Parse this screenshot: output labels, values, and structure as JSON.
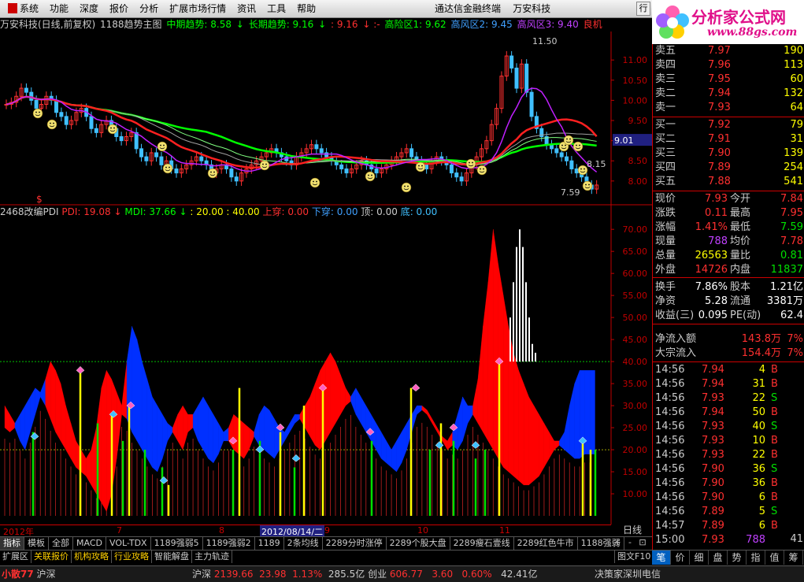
{
  "menubar": {
    "items": [
      "系统",
      "功能",
      "深度",
      "报价",
      "分析",
      "扩展市场行情",
      "资讯",
      "工具",
      "帮助"
    ],
    "app_title": "通达信金融终端",
    "company": "万安科技",
    "win_btn_label": "行"
  },
  "brand": {
    "name": "分析家公式网",
    "url": "www.88gs.com"
  },
  "price_chart": {
    "header": {
      "title": "万安科技(日线,前复权)",
      "indicator": "1188趋势主图",
      "mid_label": "中期趋势: 8.58",
      "long_label": "长期趋势: 9.16",
      "v3": ": 9.16",
      "risk_high": "高险区1: 9.62",
      "risk2": "高风区2: 9.45",
      "risk3": "高风区3: 9.40",
      "tail": "良机"
    },
    "y_ticks": [
      "11.00",
      "10.50",
      "10.00",
      "9.50",
      "9.00",
      "8.50",
      "8.00"
    ],
    "current_price_box": "9.01",
    "annot_high": "11.50",
    "annot_low": "7.59",
    "annot_mid": "8.15"
  },
  "indicator_chart": {
    "header": {
      "name": "2468改编PDI",
      "pdi": "PDI: 19.08",
      "mdi": "MDI: 37.66",
      "levels": ": 20.00 : 40.00",
      "up": "上穿: 0.00",
      "down": "下穿: 0.00",
      "top": "顶: 0.00",
      "bottom": "底: 0.00"
    },
    "y_ticks": [
      "70.00",
      "65.00",
      "60.00",
      "55.00",
      "50.00",
      "45.00",
      "40.00",
      "35.00",
      "30.00",
      "25.00",
      "20.00",
      "15.00",
      "10.00"
    ]
  },
  "date_axis": {
    "labels": [
      "2012年",
      "7",
      "8",
      "2012/08/14/二",
      "9",
      "10",
      "11"
    ],
    "period": "日线"
  },
  "tabs": [
    "指标",
    "模板",
    "全部",
    "MACD",
    "VOL-TDX",
    "1189强弱5",
    "1189强弱2",
    "1189",
    "2条均线",
    "2289分时涨停",
    "2289个股大盘",
    "2289瘦石壹线",
    "2289红色牛市",
    "1188强弱"
  ],
  "ctrl_buttons": [
    "+",
    "-",
    "⊡"
  ],
  "tabs2": [
    "扩展区",
    "关联报价",
    "机构攻略",
    "行业攻略",
    "智能解盘",
    "主力轨迹"
  ],
  "tabs2_f10": "图文F10",
  "order_book": {
    "sell": [
      {
        "label": "卖五",
        "price": "7.97",
        "vol": "190"
      },
      {
        "label": "卖四",
        "price": "7.96",
        "vol": "113"
      },
      {
        "label": "卖三",
        "price": "7.95",
        "vol": "60"
      },
      {
        "label": "卖二",
        "price": "7.94",
        "vol": "132"
      },
      {
        "label": "卖一",
        "price": "7.93",
        "vol": "64"
      }
    ],
    "buy": [
      {
        "label": "买一",
        "price": "7.92",
        "vol": "79"
      },
      {
        "label": "买二",
        "price": "7.91",
        "vol": "31"
      },
      {
        "label": "买三",
        "price": "7.90",
        "vol": "139"
      },
      {
        "label": "买四",
        "price": "7.89",
        "vol": "254"
      },
      {
        "label": "买五",
        "price": "7.88",
        "vol": "541"
      }
    ]
  },
  "quote": [
    {
      "l1": "现价",
      "v1": "7.93",
      "l2": "今开",
      "v2": "7.84",
      "c1": "#ff3030",
      "c2": "#ff3030"
    },
    {
      "l1": "涨跌",
      "v1": "0.11",
      "l2": "最高",
      "v2": "7.95",
      "c1": "#ff3030",
      "c2": "#ff3030"
    },
    {
      "l1": "涨幅",
      "v1": "1.41%",
      "l2": "最低",
      "v2": "7.59",
      "c1": "#ff3030",
      "c2": "#00e000"
    },
    {
      "l1": "现量",
      "v1": "788",
      "l2": "均价",
      "v2": "7.78",
      "c1": "#c040ff",
      "c2": "#ff3030"
    },
    {
      "l1": "总量",
      "v1": "26563",
      "l2": "量比",
      "v2": "0.81",
      "c1": "#ffff00",
      "c2": "#00e000"
    },
    {
      "l1": "外盘",
      "v1": "14726",
      "l2": "内盘",
      "v2": "11837",
      "c1": "#ff3030",
      "c2": "#00e000"
    },
    {
      "l1": "换手",
      "v1": "7.86%",
      "l2": "股本",
      "v2": "1.21亿",
      "c1": "#ffffff",
      "c2": "#ffffff"
    },
    {
      "l1": "净资",
      "v1": "5.28",
      "l2": "流通",
      "v2": "3381万",
      "c1": "#ffffff",
      "c2": "#ffffff"
    },
    {
      "l1": "收益(三)",
      "v1": "0.095",
      "l2": "PE(动)",
      "v2": "62.4",
      "c1": "#ffffff",
      "c2": "#ffffff"
    }
  ],
  "flow": [
    {
      "label": "净流入额",
      "value": "143.8万",
      "pct": "7%"
    },
    {
      "label": "大宗流入",
      "value": "154.4万",
      "pct": "7%"
    }
  ],
  "ticks": [
    {
      "time": "14:56",
      "price": "7.94",
      "vol": "4",
      "side": "B"
    },
    {
      "time": "14:56",
      "price": "7.94",
      "vol": "31",
      "side": "B"
    },
    {
      "time": "14:56",
      "price": "7.93",
      "vol": "22",
      "side": "S"
    },
    {
      "time": "14:56",
      "price": "7.94",
      "vol": "50",
      "side": "B"
    },
    {
      "time": "14:56",
      "price": "7.93",
      "vol": "40",
      "side": "S"
    },
    {
      "time": "14:56",
      "price": "7.93",
      "vol": "10",
      "side": "B"
    },
    {
      "time": "14:56",
      "price": "7.93",
      "vol": "22",
      "side": "B"
    },
    {
      "time": "14:56",
      "price": "7.90",
      "vol": "36",
      "side": "S"
    },
    {
      "time": "14:56",
      "price": "7.90",
      "vol": "36",
      "side": "B"
    },
    {
      "time": "14:56",
      "price": "7.90",
      "vol": "6",
      "side": "B"
    },
    {
      "time": "14:56",
      "price": "7.89",
      "vol": "5",
      "side": "S"
    },
    {
      "time": "14:57",
      "price": "7.89",
      "vol": "6",
      "side": "B"
    },
    {
      "time": "15:00",
      "price": "7.93",
      "vol": "788",
      "side": ""
    }
  ],
  "tick_last_extra": "41",
  "bottom_tabs": [
    "笔",
    "价",
    "细",
    "盘",
    "势",
    "指",
    "值",
    "筹"
  ],
  "statusbar": {
    "left": "小散77",
    "market": "沪深",
    "sh_label": "沪深",
    "sh_index": "2139.66",
    "sh_change": "23.98",
    "sh_pct": "1.13%",
    "vol": "285.5亿",
    "sz_label": "创业",
    "sz_index": "606.77",
    "sz_change": "3.60",
    "sz_pct": "0.60%",
    "sz_vol": "42.41亿",
    "right": "决策家深圳电信"
  },
  "colors": {
    "up": "#ff3030",
    "down": "#00e000",
    "axis": "#c00000",
    "pdi": "#ff0000",
    "mdi": "#0040ff"
  }
}
